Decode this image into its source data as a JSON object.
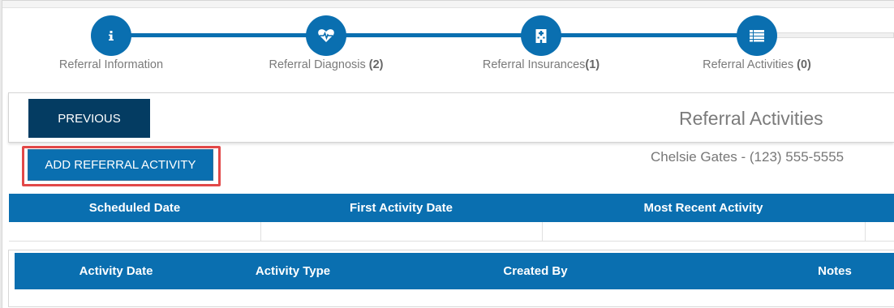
{
  "stepper": {
    "steps": [
      {
        "label": "Referral Information",
        "count": "",
        "icon": "info-icon"
      },
      {
        "label": "Referral Diagnosis ",
        "count": "(2)",
        "icon": "heartbeat-icon"
      },
      {
        "label": "Referral Insurances",
        "count": "(1)",
        "icon": "hospital-icon"
      },
      {
        "label": "Referral Activities ",
        "count": "(0)",
        "icon": "list-icon"
      }
    ]
  },
  "header": {
    "previous_label": "PREVIOUS",
    "title": "Referral Activities"
  },
  "actions": {
    "add_activity_label": "ADD REFERRAL ACTIVITY"
  },
  "patient": {
    "info": "Chelsie Gates - (123) 555-5555"
  },
  "referral_table": {
    "columns": [
      "Scheduled Date",
      "First Activity Date",
      "Most Recent Activity"
    ]
  },
  "activity_table": {
    "columns": [
      "Activity Date",
      "Activity Type",
      "Created By",
      "Notes"
    ]
  },
  "colors": {
    "primary": "#0a6fb0",
    "dark_navy": "#043c62",
    "highlight": "#e24848"
  }
}
